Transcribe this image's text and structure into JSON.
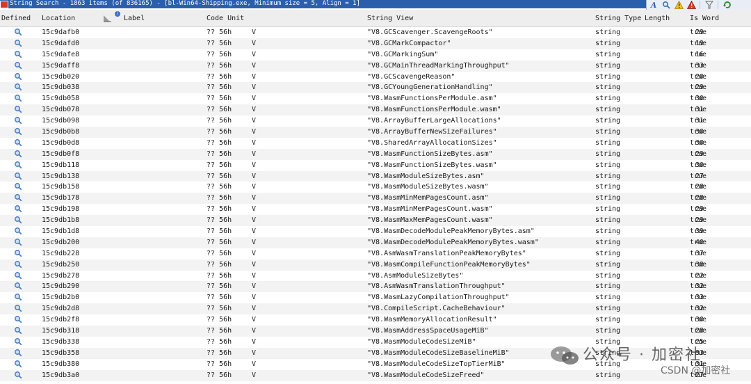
{
  "window": {
    "title": "String Search - 1863 items (of 836165) - [bl-Win64-Shipping.exe, Minimum size = 5, Align = 1]"
  },
  "toolbar": {
    "buttons": [
      "string-view-icon",
      "search-icon",
      "warning-icon",
      "error-icon",
      "filter-icon",
      "refresh-icon"
    ]
  },
  "header": {
    "defined": "Defined",
    "location": "Location",
    "label": "Label",
    "code_unit": "Code Unit",
    "string_view": "String View",
    "string_type": "String Type",
    "length": "Length",
    "is_word": "Is Word",
    "filter_badge": "i"
  },
  "rows": [
    {
      "location": "15c9dafb0",
      "code": "?? 56h",
      "v": "V",
      "str": "\"V8.GCScavenger.ScavengeRoots\"",
      "type": "string",
      "len": "29",
      "word": "true"
    },
    {
      "location": "15c9dafd0",
      "code": "?? 56h",
      "v": "V",
      "str": "\"V8.GCMarkCompactor\"",
      "type": "string",
      "len": "19",
      "word": "true"
    },
    {
      "location": "15c9dafe8",
      "code": "?? 56h",
      "v": "V",
      "str": "\"V8.GCMarkingSum\"",
      "type": "string",
      "len": "16",
      "word": "true"
    },
    {
      "location": "15c9daff8",
      "code": "?? 56h",
      "v": "V",
      "str": "\"V8.GCMainThreadMarkingThroughput\"",
      "type": "string",
      "len": "33",
      "word": "true"
    },
    {
      "location": "15c9db020",
      "code": "?? 56h",
      "v": "V",
      "str": "\"V8.GCScavengeReason\"",
      "type": "string",
      "len": "20",
      "word": "true"
    },
    {
      "location": "15c9db038",
      "code": "?? 56h",
      "v": "V",
      "str": "\"V8.GCYoungGenerationHandling\"",
      "type": "string",
      "len": "29",
      "word": "true"
    },
    {
      "location": "15c9db058",
      "code": "?? 56h",
      "v": "V",
      "str": "\"V8.WasmFunctionsPerModule.asm\"",
      "type": "string",
      "len": "30",
      "word": "true"
    },
    {
      "location": "15c9db078",
      "code": "?? 56h",
      "v": "V",
      "str": "\"V8.WasmFunctionsPerModule.wasm\"",
      "type": "string",
      "len": "31",
      "word": "true"
    },
    {
      "location": "15c9db098",
      "code": "?? 56h",
      "v": "V",
      "str": "\"V8.ArrayBufferLargeAllocations\"",
      "type": "string",
      "len": "31",
      "word": "true"
    },
    {
      "location": "15c9db0b8",
      "code": "?? 56h",
      "v": "V",
      "str": "\"V8.ArrayBufferNewSizeFailures\"",
      "type": "string",
      "len": "30",
      "word": "true"
    },
    {
      "location": "15c9db0d8",
      "code": "?? 56h",
      "v": "V",
      "str": "\"V8.SharedArrayAllocationSizes\"",
      "type": "string",
      "len": "30",
      "word": "true"
    },
    {
      "location": "15c9db0f8",
      "code": "?? 56h",
      "v": "V",
      "str": "\"V8.WasmFunctionSizeBytes.asm\"",
      "type": "string",
      "len": "29",
      "word": "true"
    },
    {
      "location": "15c9db118",
      "code": "?? 56h",
      "v": "V",
      "str": "\"V8.WasmFunctionSizeBytes.wasm\"",
      "type": "string",
      "len": "30",
      "word": "true"
    },
    {
      "location": "15c9db138",
      "code": "?? 56h",
      "v": "V",
      "str": "\"V8.WasmModuleSizeBytes.asm\"",
      "type": "string",
      "len": "27",
      "word": "true"
    },
    {
      "location": "15c9db158",
      "code": "?? 56h",
      "v": "V",
      "str": "\"V8.WasmModuleSizeBytes.wasm\"",
      "type": "string",
      "len": "28",
      "word": "true"
    },
    {
      "location": "15c9db178",
      "code": "?? 56h",
      "v": "V",
      "str": "\"V8.WasmMinMemPagesCount.asm\"",
      "type": "string",
      "len": "28",
      "word": "true"
    },
    {
      "location": "15c9db198",
      "code": "?? 56h",
      "v": "V",
      "str": "\"V8.WasmMinMemPagesCount.wasm\"",
      "type": "string",
      "len": "29",
      "word": "true"
    },
    {
      "location": "15c9db1b8",
      "code": "?? 56h",
      "v": "V",
      "str": "\"V8.WasmMaxMemPagesCount.wasm\"",
      "type": "string",
      "len": "29",
      "word": "true"
    },
    {
      "location": "15c9db1d8",
      "code": "?? 56h",
      "v": "V",
      "str": "\"V8.WasmDecodeModulePeakMemoryBytes.asm\"",
      "type": "string",
      "len": "39",
      "word": "true"
    },
    {
      "location": "15c9db200",
      "code": "?? 56h",
      "v": "V",
      "str": "\"V8.WasmDecodeModulePeakMemoryBytes.wasm\"",
      "type": "string",
      "len": "40",
      "word": "true"
    },
    {
      "location": "15c9db228",
      "code": "?? 56h",
      "v": "V",
      "str": "\"V8.AsmWasmTranslationPeakMemoryBytes\"",
      "type": "string",
      "len": "37",
      "word": "true"
    },
    {
      "location": "15c9db250",
      "code": "?? 56h",
      "v": "V",
      "str": "\"V8.WasmCompileFunctionPeakMemoryBytes\"",
      "type": "string",
      "len": "38",
      "word": "true"
    },
    {
      "location": "15c9db278",
      "code": "?? 56h",
      "v": "V",
      "str": "\"V8.AsmModuleSizeBytes\"",
      "type": "string",
      "len": "22",
      "word": "true"
    },
    {
      "location": "15c9db290",
      "code": "?? 56h",
      "v": "V",
      "str": "\"V8.AsmWasmTranslationThroughput\"",
      "type": "string",
      "len": "32",
      "word": "true"
    },
    {
      "location": "15c9db2b0",
      "code": "?? 56h",
      "v": "V",
      "str": "\"V8.WasmLazyCompilationThroughput\"",
      "type": "string",
      "len": "33",
      "word": "true"
    },
    {
      "location": "15c9db2d8",
      "code": "?? 56h",
      "v": "V",
      "str": "\"V8.CompileScript.CacheBehaviour\"",
      "type": "string",
      "len": "32",
      "word": "true"
    },
    {
      "location": "15c9db2f8",
      "code": "?? 56h",
      "v": "V",
      "str": "\"V8.WasmMemoryAllocationResult\"",
      "type": "string",
      "len": "30",
      "word": "true"
    },
    {
      "location": "15c9db318",
      "code": "?? 56h",
      "v": "V",
      "str": "\"V8.WasmAddressSpaceUsageMiB\"",
      "type": "string",
      "len": "28",
      "word": "true"
    },
    {
      "location": "15c9db338",
      "code": "?? 56h",
      "v": "V",
      "str": "\"V8.WasmModuleCodeSizeMiB\"",
      "type": "string",
      "len": "25",
      "word": "true"
    },
    {
      "location": "15c9db358",
      "code": "?? 56h",
      "v": "V",
      "str": "\"V8.WasmModuleCodeSizeBaselineMiB\"",
      "type": "string",
      "len": "33",
      "word": "true"
    },
    {
      "location": "15c9db380",
      "code": "?? 56h",
      "v": "V",
      "str": "\"V8.WasmModuleCodeSizeTopTierMiB\"",
      "type": "string",
      "len": "31",
      "word": "true"
    },
    {
      "location": "15c9db3a0",
      "code": "?? 56h",
      "v": "V",
      "str": "\"V8.WasmModuleCodeSizeFreed\"",
      "type": "string",
      "len": "27",
      "word": "true"
    }
  ],
  "watermark": {
    "main": "公众号 · 加密社",
    "sub": "CSDN @加密社"
  },
  "colors": {
    "titlebar": "#2b5fae",
    "header_bg": "#eeeeee",
    "row_alt": "#f3f3f3",
    "magnifier": "#4a7bbf"
  }
}
